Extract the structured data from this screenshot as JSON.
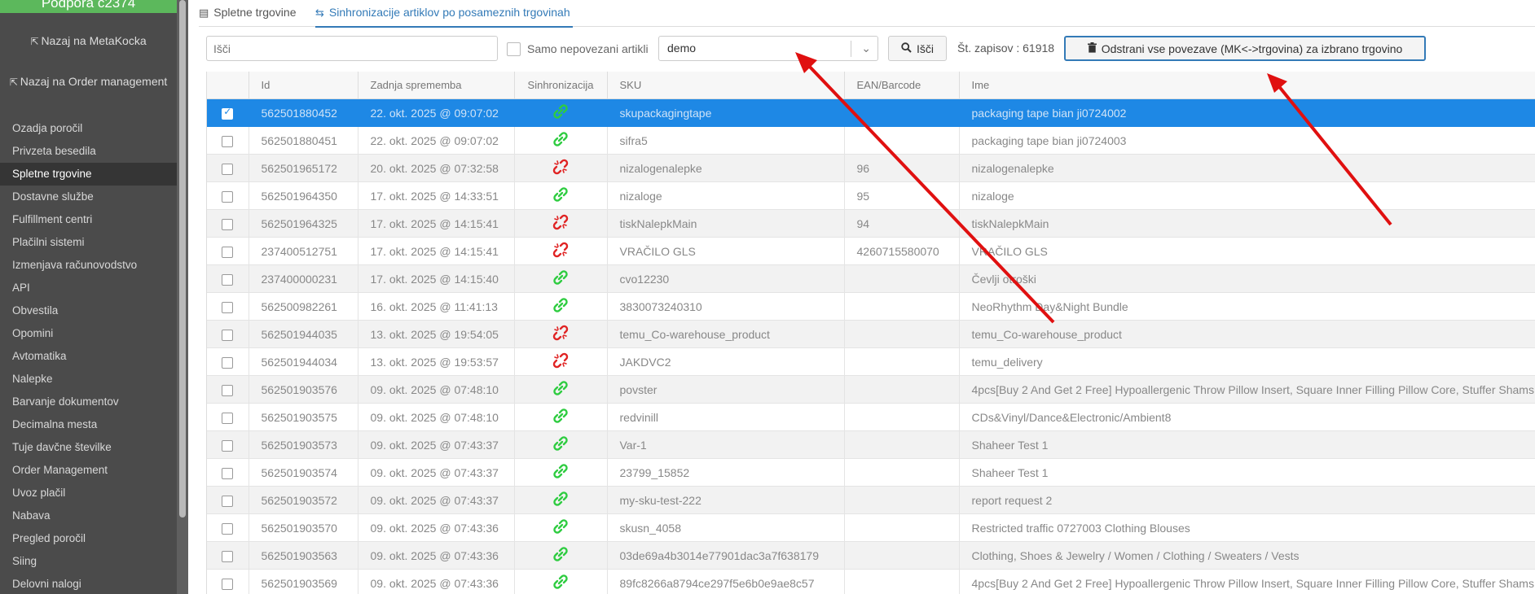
{
  "sidebar": {
    "header": "Podpora c2374",
    "back_metakocka": "Nazaj na MetaKocka",
    "back_order": "Nazaj na Order management",
    "items": [
      {
        "label": "Ozadja poročil"
      },
      {
        "label": "Privzeta besedila"
      },
      {
        "label": "Spletne trgovine"
      },
      {
        "label": "Dostavne službe"
      },
      {
        "label": "Fulfillment centri"
      },
      {
        "label": "Plačilni sistemi"
      },
      {
        "label": "Izmenjava računovodstvo"
      },
      {
        "label": "API"
      },
      {
        "label": "Obvestila"
      },
      {
        "label": "Opomini"
      },
      {
        "label": "Avtomatika"
      },
      {
        "label": "Nalepke"
      },
      {
        "label": "Barvanje dokumentov"
      },
      {
        "label": "Decimalna mesta"
      },
      {
        "label": "Tuje davčne številke"
      },
      {
        "label": "Order Management"
      },
      {
        "label": "Uvoz plačil"
      },
      {
        "label": "Nabava"
      },
      {
        "label": "Pregled poročil"
      },
      {
        "label": "Siing"
      },
      {
        "label": "Delovni nalogi"
      }
    ],
    "active_item": "Spletne trgovine"
  },
  "tabs": [
    {
      "label": "Spletne trgovine",
      "icon": "store-icon"
    },
    {
      "label": "Sinhronizacije artiklov po posameznih trgovinah",
      "icon": "sync-arrows-icon"
    }
  ],
  "toolbar": {
    "search_placeholder": "Išči",
    "unlinked_label": "Samo nepovezani artikli",
    "store_select_value": "demo",
    "search_button": "Išči",
    "record_count": "Št. zapisov : 61918",
    "remove_button": "Odstrani vse povezave (MK<->trgovina) za izbrano trgovino"
  },
  "colors": {
    "linked": "#2ecc40",
    "unlinked": "#e02424",
    "selected_row": "#1e88e5",
    "active_tab": "#337ab7",
    "annotation_arrow": "#e01010"
  },
  "table": {
    "columns": [
      "Id",
      "Zadnja sprememba",
      "Sinhronizacija",
      "SKU",
      "EAN/Barcode",
      "Ime"
    ],
    "rows": [
      {
        "id": "562501880452",
        "modified": "22. okt. 2025 @ 09:07:02",
        "sync": "linked",
        "sku": "skupackagingtape",
        "ean": "",
        "name": "packaging tape bian ji0724002",
        "selected": true
      },
      {
        "id": "562501880451",
        "modified": "22. okt. 2025 @ 09:07:02",
        "sync": "linked",
        "sku": "sifra5",
        "ean": "",
        "name": "packaging tape bian ji0724003"
      },
      {
        "id": "562501965172",
        "modified": "20. okt. 2025 @ 07:32:58",
        "sync": "unlinked",
        "sku": "nizalogenalepke",
        "ean": "96",
        "name": "nizalogenalepke"
      },
      {
        "id": "562501964350",
        "modified": "17. okt. 2025 @ 14:33:51",
        "sync": "linked",
        "sku": "nizaloge",
        "ean": "95",
        "name": "nizaloge"
      },
      {
        "id": "562501964325",
        "modified": "17. okt. 2025 @ 14:15:41",
        "sync": "unlinked",
        "sku": "tiskNalepkMain",
        "ean": "94",
        "name": "tiskNalepkMain"
      },
      {
        "id": "237400512751",
        "modified": "17. okt. 2025 @ 14:15:41",
        "sync": "unlinked",
        "sku": "VRAČILO GLS",
        "ean": "4260715580070",
        "name": "VRAČILO GLS"
      },
      {
        "id": "237400000231",
        "modified": "17. okt. 2025 @ 14:15:40",
        "sync": "linked",
        "sku": "cvo12230",
        "ean": "",
        "name": "Čevlji otroški"
      },
      {
        "id": "562500982261",
        "modified": "16. okt. 2025 @ 11:41:13",
        "sync": "linked",
        "sku": "3830073240310",
        "ean": "",
        "name": "NeoRhythm Day&Night Bundle"
      },
      {
        "id": "562501944035",
        "modified": "13. okt. 2025 @ 19:54:05",
        "sync": "unlinked",
        "sku": "temu_Co-warehouse_product",
        "ean": "",
        "name": "temu_Co-warehouse_product"
      },
      {
        "id": "562501944034",
        "modified": "13. okt. 2025 @ 19:53:57",
        "sync": "unlinked",
        "sku": "JAKDVC2",
        "ean": "",
        "name": "temu_delivery"
      },
      {
        "id": "562501903576",
        "modified": "09. okt. 2025 @ 07:48:10",
        "sync": "linked",
        "sku": "povster",
        "ean": "",
        "name": "4pcs[Buy 2 And Get 2 Free] Hypoallergenic Throw Pillow Insert, Square Inner Filling Pillow Core, Stuffer Shams"
      },
      {
        "id": "562501903575",
        "modified": "09. okt. 2025 @ 07:48:10",
        "sync": "linked",
        "sku": "redvinill",
        "ean": "",
        "name": "CDs&Vinyl/Dance&Electronic/Ambient8"
      },
      {
        "id": "562501903573",
        "modified": "09. okt. 2025 @ 07:43:37",
        "sync": "linked",
        "sku": "Var-1",
        "ean": "",
        "name": "Shaheer Test 1"
      },
      {
        "id": "562501903574",
        "modified": "09. okt. 2025 @ 07:43:37",
        "sync": "linked",
        "sku": "23799_15852",
        "ean": "",
        "name": "Shaheer Test 1"
      },
      {
        "id": "562501903572",
        "modified": "09. okt. 2025 @ 07:43:37",
        "sync": "linked",
        "sku": "my-sku-test-222",
        "ean": "",
        "name": "report request 2"
      },
      {
        "id": "562501903570",
        "modified": "09. okt. 2025 @ 07:43:36",
        "sync": "linked",
        "sku": "skusn_4058",
        "ean": "",
        "name": "Restricted traffic 0727003 Clothing Blouses"
      },
      {
        "id": "562501903563",
        "modified": "09. okt. 2025 @ 07:43:36",
        "sync": "linked",
        "sku": "03de69a4b3014e77901dac3a7f638179",
        "ean": "",
        "name": "Clothing, Shoes & Jewelry / Women / Clothing / Sweaters / Vests"
      },
      {
        "id": "562501903569",
        "modified": "09. okt. 2025 @ 07:43:36",
        "sync": "linked",
        "sku": "89fc8266a8794ce297f5e6b0e9ae8c57",
        "ean": "",
        "name": "4pcs[Buy 2 And Get 2 Free] Hypoallergenic Throw Pillow Insert, Square Inner Filling Pillow Core, Stuffer Shams"
      }
    ]
  }
}
